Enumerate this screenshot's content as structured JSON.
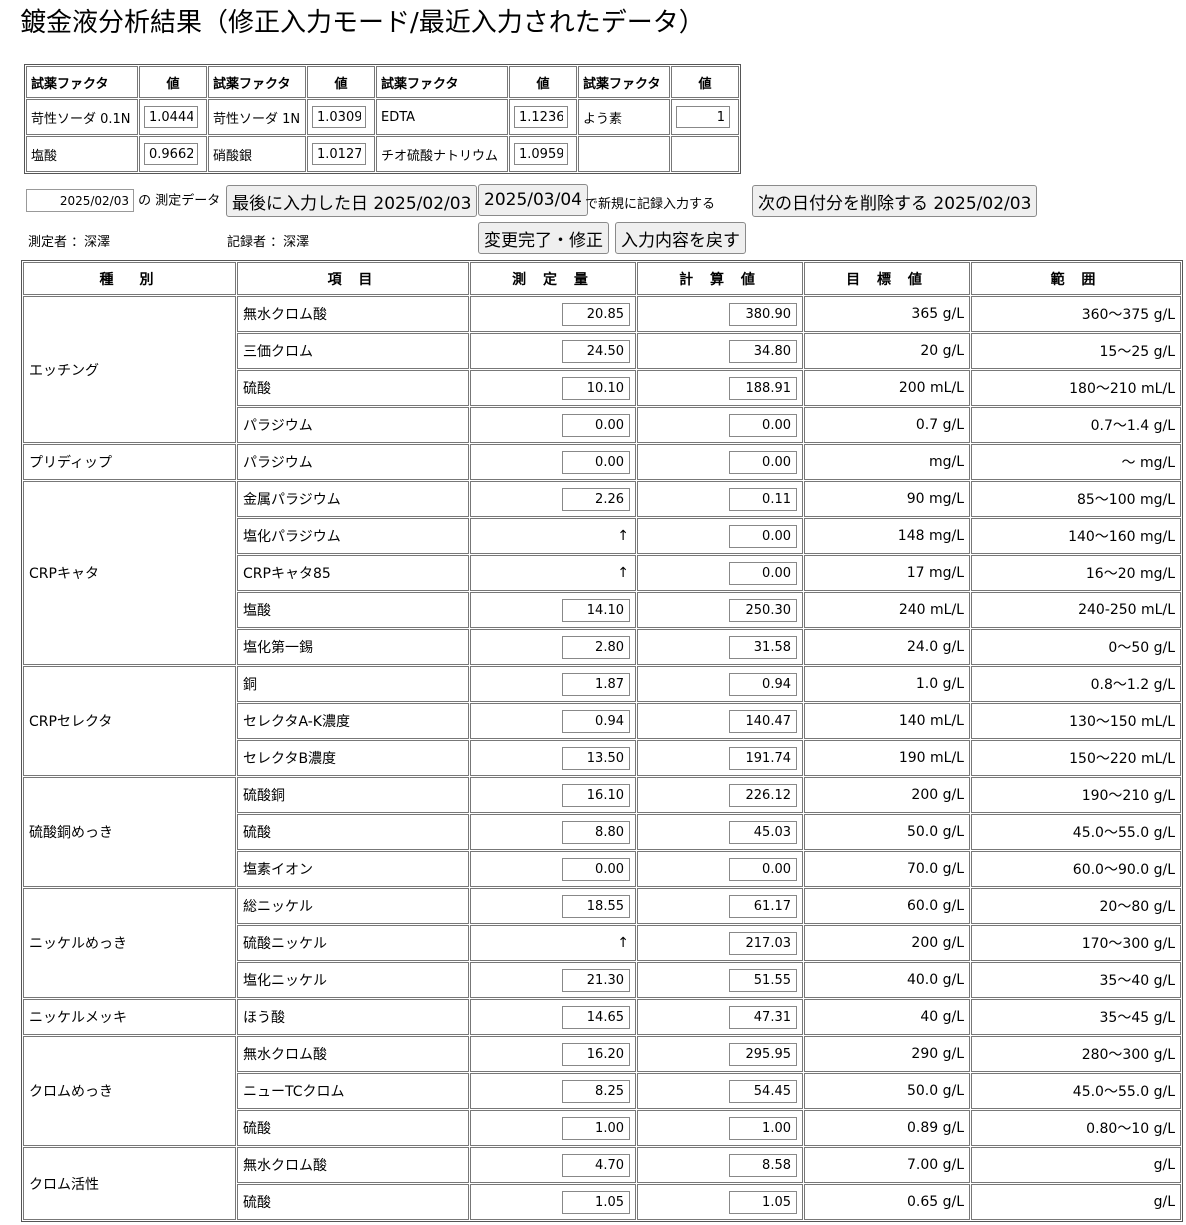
{
  "title": "鍍金液分析結果（修正入力モード/最近入力されたデータ）",
  "factors": {
    "header_name": "試薬ファクタ",
    "header_value": "値",
    "rows": [
      [
        {
          "name": "苛性ソーダ 0.1N",
          "value": "1.0444"
        },
        {
          "name": "苛性ソーダ 1N",
          "value": "1.0309"
        },
        {
          "name": "EDTA",
          "value": "1.1236"
        },
        {
          "name": "よう素",
          "value": "1"
        }
      ],
      [
        {
          "name": "塩酸",
          "value": "0.9662"
        },
        {
          "name": "硝酸銀",
          "value": "1.0127"
        },
        {
          "name": "チオ硫酸ナトリウム",
          "value": "1.0959"
        },
        {
          "name": "",
          "value": ""
        }
      ]
    ]
  },
  "controls": {
    "date_value": "2025/02/03",
    "date_suffix": "の 測定データ",
    "last_date_button": "最後に入力した日 2025/02/03",
    "new_date_button": "2025/03/04",
    "new_record_text": "で新規に記録入力する",
    "delete_button": "次の日付分を削除する 2025/02/03",
    "measurer": "測定者 ：深澤",
    "recorder": "記録者 ：深澤",
    "complete_button": "変更完了・修正",
    "revert_button": "入力内容を戻す"
  },
  "table": {
    "headers": [
      "種　別",
      "項 目",
      "測 定 量",
      "計 算 値",
      "目 標 値",
      "範 囲"
    ],
    "groups": [
      {
        "category": "エッチング",
        "rows": [
          {
            "item": "無水クロム酸",
            "measured": "20.85",
            "calc": "380.90",
            "target": "365 g/L",
            "range": "360〜375 g/L"
          },
          {
            "item": "三価クロム",
            "measured": "24.50",
            "calc": "34.80",
            "target": "20 g/L",
            "range": "15〜25 g/L"
          },
          {
            "item": "硫酸",
            "measured": "10.10",
            "calc": "188.91",
            "target": "200 mL/L",
            "range": "180〜210 mL/L"
          },
          {
            "item": "パラジウム",
            "measured": "0.00",
            "calc": "0.00",
            "target": "0.7 g/L",
            "range": "0.7〜1.4 g/L"
          }
        ]
      },
      {
        "category": "プリディップ",
        "rows": [
          {
            "item": "パラジウム",
            "measured": "0.00",
            "calc": "0.00",
            "target": "mg/L",
            "range": "〜 mg/L"
          }
        ]
      },
      {
        "category": "CRPキャタ",
        "rows": [
          {
            "item": "金属パラジウム",
            "measured": "2.26",
            "calc": "0.11",
            "target": "90 mg/L",
            "range": "85〜100 mg/L"
          },
          {
            "item": "塩化パラジウム",
            "measured": "↑",
            "calc": "0.00",
            "target": "148 mg/L",
            "range": "140〜160 mg/L"
          },
          {
            "item": "CRPキャタ85",
            "measured": "↑",
            "calc": "0.00",
            "target": "17 mg/L",
            "range": "16〜20 mg/L"
          },
          {
            "item": "塩酸",
            "measured": "14.10",
            "calc": "250.30",
            "target": "240 mL/L",
            "range": "240-250 mL/L"
          },
          {
            "item": "塩化第一錫",
            "measured": "2.80",
            "calc": "31.58",
            "target": "24.0 g/L",
            "range": "0〜50 g/L"
          }
        ]
      },
      {
        "category": "CRPセレクタ",
        "rows": [
          {
            "item": "銅",
            "measured": "1.87",
            "calc": "0.94",
            "target": "1.0 g/L",
            "range": "0.8〜1.2 g/L"
          },
          {
            "item": "セレクタA-K濃度",
            "measured": "0.94",
            "calc": "140.47",
            "target": "140 mL/L",
            "range": "130〜150 mL/L"
          },
          {
            "item": "セレクタB濃度",
            "measured": "13.50",
            "calc": "191.74",
            "target": "190 mL/L",
            "range": "150〜220 mL/L"
          }
        ]
      },
      {
        "category": "硫酸銅めっき",
        "rows": [
          {
            "item": "硫酸銅",
            "measured": "16.10",
            "calc": "226.12",
            "target": "200 g/L",
            "range": "190〜210 g/L"
          },
          {
            "item": "硫酸",
            "measured": "8.80",
            "calc": "45.03",
            "target": "50.0 g/L",
            "range": "45.0〜55.0 g/L"
          },
          {
            "item": "塩素イオン",
            "measured": "0.00",
            "calc": "0.00",
            "target": "70.0 g/L",
            "range": "60.0〜90.0 g/L"
          }
        ]
      },
      {
        "category": "ニッケルめっき",
        "rows": [
          {
            "item": "総ニッケル",
            "measured": "18.55",
            "calc": "61.17",
            "target": "60.0 g/L",
            "range": "20〜80 g/L"
          },
          {
            "item": "硫酸ニッケル",
            "measured": "↑",
            "calc": "217.03",
            "target": "200 g/L",
            "range": "170〜300 g/L"
          },
          {
            "item": "塩化ニッケル",
            "measured": "21.30",
            "calc": "51.55",
            "target": "40.0 g/L",
            "range": "35〜40 g/L"
          }
        ]
      },
      {
        "category": "ニッケルメッキ",
        "rows": [
          {
            "item": "ほう酸",
            "measured": "14.65",
            "calc": "47.31",
            "target": "40 g/L",
            "range": "35〜45 g/L"
          }
        ]
      },
      {
        "category": "クロムめっき",
        "rows": [
          {
            "item": "無水クロム酸",
            "measured": "16.20",
            "calc": "295.95",
            "target": "290 g/L",
            "range": "280〜300 g/L"
          },
          {
            "item": "ニューTCクロム",
            "measured": "8.25",
            "calc": "54.45",
            "target": "50.0 g/L",
            "range": "45.0〜55.0 g/L"
          },
          {
            "item": "硫酸",
            "measured": "1.00",
            "calc": "1.00",
            "target": "0.89 g/L",
            "range": "0.80〜10 g/L"
          }
        ]
      },
      {
        "category": "クロム活性",
        "rows": [
          {
            "item": "無水クロム酸",
            "measured": "4.70",
            "calc": "8.58",
            "target": "7.00 g/L",
            "range": "g/L"
          },
          {
            "item": "硫酸",
            "measured": "1.05",
            "calc": "1.05",
            "target": "0.65 g/L",
            "range": "g/L"
          }
        ]
      }
    ]
  }
}
